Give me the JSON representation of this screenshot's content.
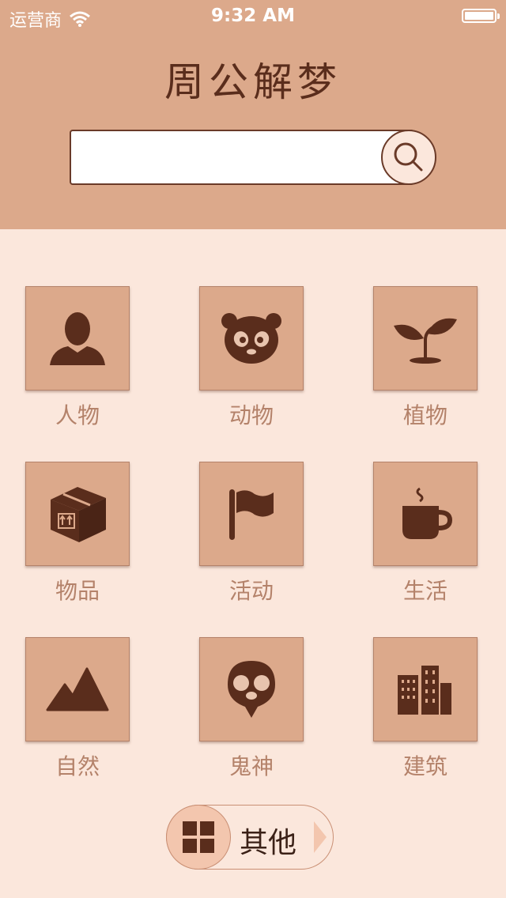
{
  "status_bar": {
    "carrier": "运营商",
    "time": "9:32 AM"
  },
  "app": {
    "title": "周公解梦"
  },
  "search": {
    "value": "",
    "placeholder": ""
  },
  "categories": [
    {
      "label": "人物",
      "icon": "person-icon"
    },
    {
      "label": "动物",
      "icon": "panda-icon"
    },
    {
      "label": "植物",
      "icon": "sprout-icon"
    },
    {
      "label": "物品",
      "icon": "box-icon"
    },
    {
      "label": "活动",
      "icon": "flag-icon"
    },
    {
      "label": "生活",
      "icon": "coffee-icon"
    },
    {
      "label": "自然",
      "icon": "mountain-icon"
    },
    {
      "label": "鬼神",
      "icon": "ghost-icon"
    },
    {
      "label": "建筑",
      "icon": "building-icon"
    }
  ],
  "other_button": {
    "label": "其他",
    "icon": "grid-icon"
  },
  "colors": {
    "header_bg": "#dca98b",
    "page_bg": "#fbe7dc",
    "icon_dark": "#5a2d1c",
    "label": "#b4826a"
  }
}
